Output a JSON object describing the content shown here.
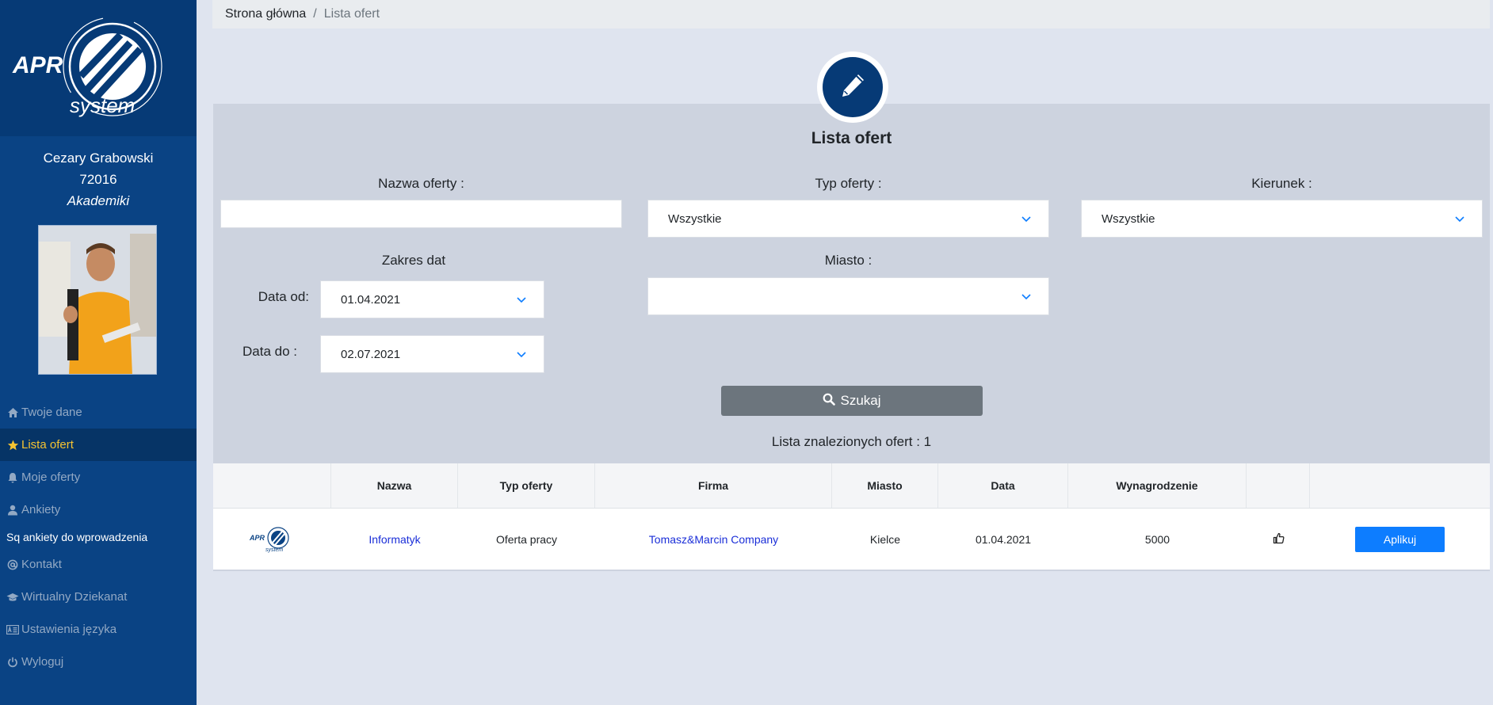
{
  "brand": {
    "logo_word": "APR",
    "logo_sub": "system",
    "primary": "#063a76",
    "accent": "#f5c332"
  },
  "user": {
    "name": "Cezary Grabowski",
    "id": "72016",
    "group": "Akademiki"
  },
  "nav": {
    "items": [
      {
        "label": "Twoje dane",
        "icon": "home-icon"
      },
      {
        "label": "Lista ofert",
        "icon": "star-icon",
        "active": true
      },
      {
        "label": "Moje oferty",
        "icon": "bell-icon"
      },
      {
        "label": "Ankiety",
        "icon": "user-icon"
      }
    ],
    "sub_label": "Sq ankiety do wprowadzenia",
    "items2": [
      {
        "label": "Kontakt",
        "icon": "at-icon"
      },
      {
        "label": "Wirtualny Dziekanat",
        "icon": "graduation-cap-icon"
      },
      {
        "label": "Ustawienia języka",
        "icon": "language-icon"
      },
      {
        "label": "Wyloguj",
        "icon": "power-icon"
      }
    ]
  },
  "breadcrumb": {
    "home": "Strona główna",
    "separator": "/",
    "current": "Lista ofert"
  },
  "page": {
    "title": "Lista ofert",
    "icon": "pencil-icon"
  },
  "filters": {
    "name_label": "Nazwa oferty :",
    "name_value": "",
    "type_label": "Typ oferty :",
    "type_value": "Wszystkie",
    "direction_label": "Kierunek :",
    "direction_value": "Wszystkie",
    "date_range_label": "Zakres dat",
    "date_from_label": "Data od:",
    "date_from_value": "01.04.2021",
    "date_to_label": "Data do :",
    "date_to_value": "02.07.2021",
    "city_label": "Miasto :",
    "city_value": ""
  },
  "search": {
    "label": "Szukaj"
  },
  "results": {
    "label": "Lista znalezionych ofert : 1"
  },
  "table": {
    "headers": [
      "",
      "Nazwa",
      "Typ oferty",
      "Firma",
      "Miasto",
      "Data",
      "Wynagrodzenie",
      "",
      ""
    ],
    "rows": [
      {
        "name": "Informatyk",
        "type": "Oferta pracy",
        "company": "Tomasz&Marcin Company",
        "city": "Kielce",
        "date": "01.04.2021",
        "salary": "5000",
        "action": "Aplikuj"
      }
    ]
  }
}
